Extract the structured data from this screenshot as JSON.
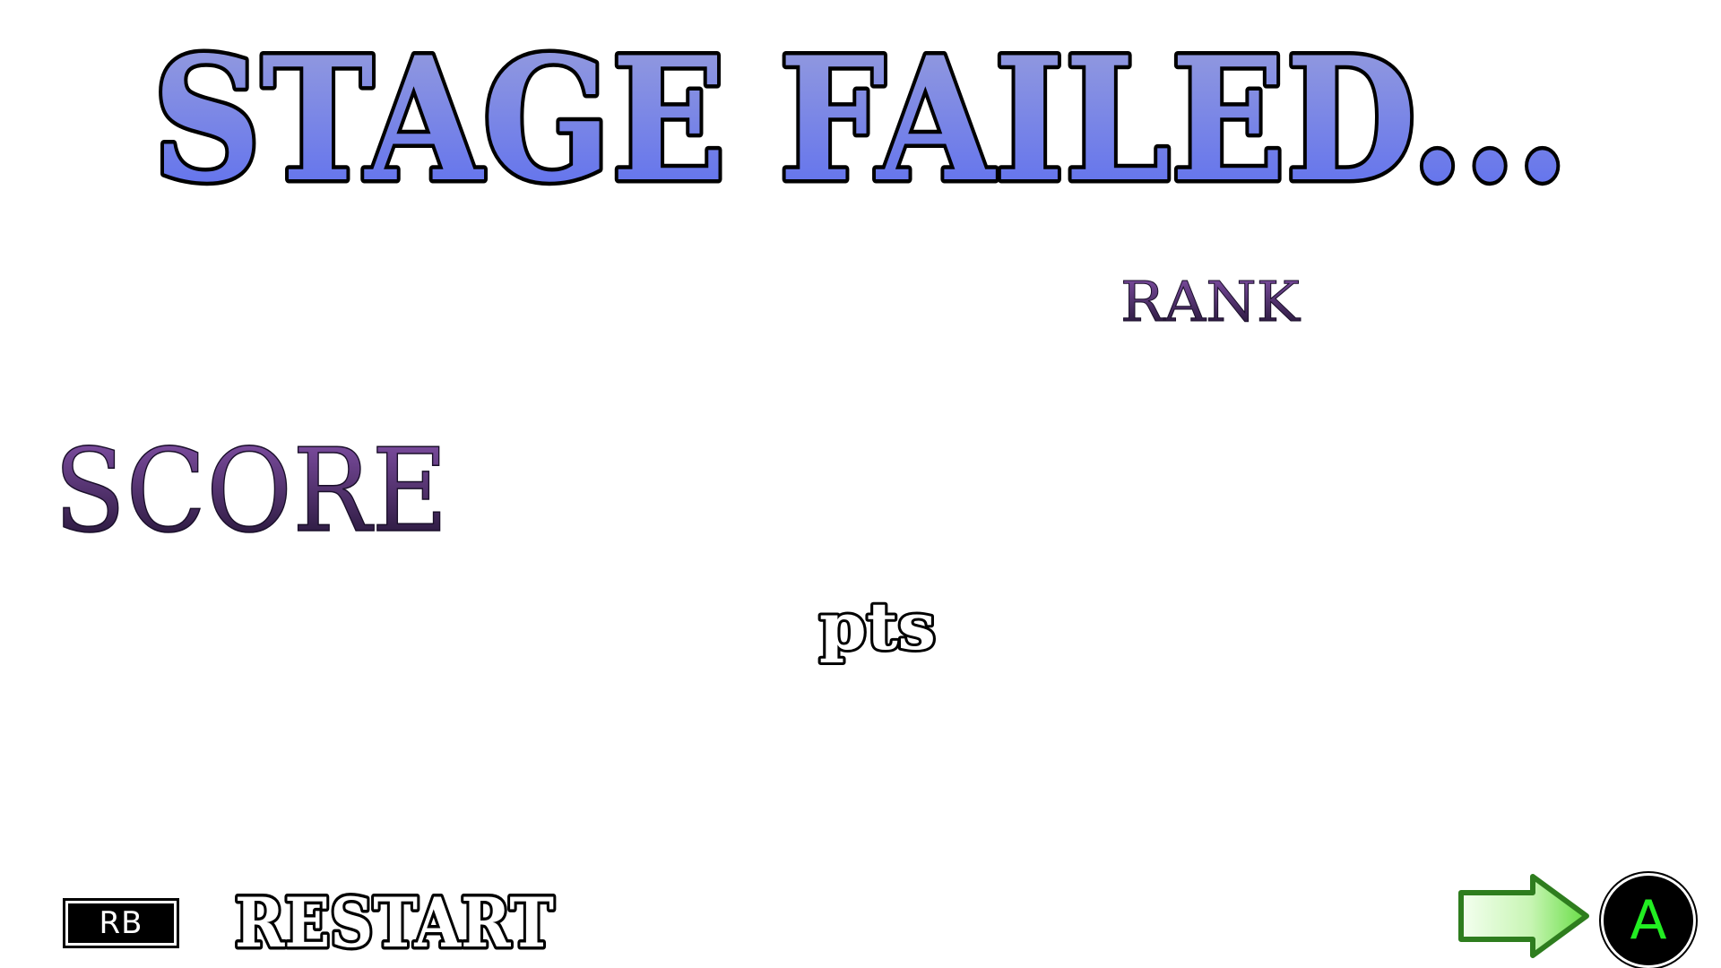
{
  "title": "STAGE FAILED...",
  "labels": {
    "rank": "RANK",
    "score": "SCORE",
    "pts": "pts"
  },
  "controls": {
    "restart_key": "RB",
    "restart_label": "RESTART",
    "next_key": "A"
  },
  "icons": {
    "next": "right-arrow-icon"
  },
  "colors": {
    "title_top": "#9aa0dc",
    "title_bottom": "#5a6cf0",
    "label_purple": "#8a55b0",
    "label_dark": "#1a0f2a",
    "arrow_fill_light": "#f4fff0",
    "arrow_fill_green": "#66dd44",
    "arrow_stroke": "#2e7d1e",
    "a_button_text": "#22ee22"
  }
}
